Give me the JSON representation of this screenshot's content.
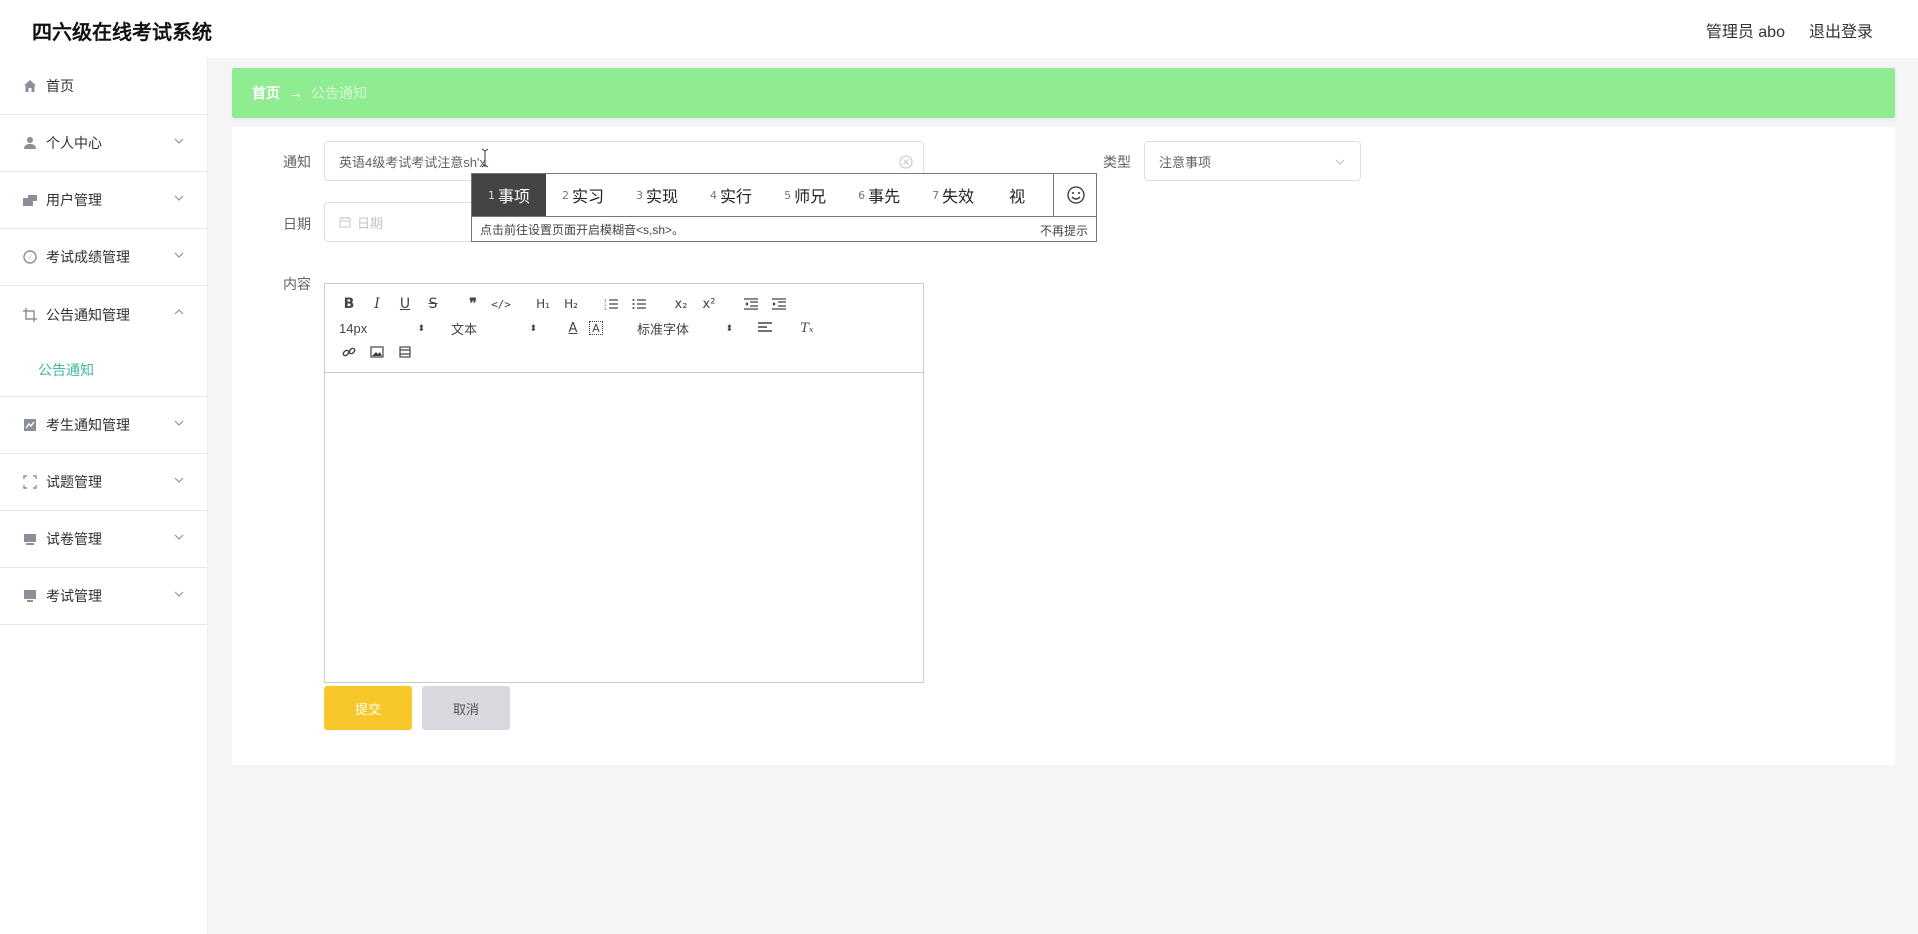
{
  "header": {
    "app_title": "四六级在线考试系统",
    "user_label": "管理员 abo",
    "logout_label": "退出登录"
  },
  "sidebar": {
    "items": [
      {
        "label": "首页",
        "icon": "home-icon"
      },
      {
        "label": "个人中心",
        "icon": "user-icon"
      },
      {
        "label": "用户管理",
        "icon": "users-icon"
      },
      {
        "label": "考试成绩管理",
        "icon": "compass-icon"
      },
      {
        "label": "公告通知管理",
        "icon": "crop-icon",
        "expanded": true,
        "children": [
          {
            "label": "公告通知",
            "active": true
          }
        ]
      },
      {
        "label": "考生通知管理",
        "icon": "chart-icon"
      },
      {
        "label": "试题管理",
        "icon": "fullscreen-icon"
      },
      {
        "label": "试卷管理",
        "icon": "stack-icon"
      },
      {
        "label": "考试管理",
        "icon": "monitor-icon"
      }
    ]
  },
  "breadcrumb": {
    "home": "首页",
    "arrow": "→",
    "current": "公告通知"
  },
  "form": {
    "notice_label": "通知",
    "notice_value": "英语4级考试考试注意sh'x",
    "type_label": "类型",
    "type_value": "注意事项",
    "date_label": "日期",
    "date_placeholder": "日期",
    "content_label": "内容"
  },
  "editor": {
    "font_size": "14px",
    "header_select": "文本",
    "font_family_select": "标准字体"
  },
  "buttons": {
    "submit": "提交",
    "cancel": "取消"
  },
  "ime": {
    "candidates": [
      {
        "num": "1",
        "text": "事项"
      },
      {
        "num": "2",
        "text": "实习"
      },
      {
        "num": "3",
        "text": "实现"
      },
      {
        "num": "4",
        "text": "实行"
      },
      {
        "num": "5",
        "text": "师兄"
      },
      {
        "num": "6",
        "text": "事先"
      },
      {
        "num": "7",
        "text": "失效"
      },
      {
        "num": "",
        "text": "视"
      }
    ],
    "tip": "点击前往设置页面开启模糊音<s,sh>。",
    "dismiss": "不再提示"
  },
  "colors": {
    "breadcrumb_bg": "#90ec90",
    "submit_bg": "#f8c82a",
    "active_submenu": "#41b8a0"
  }
}
